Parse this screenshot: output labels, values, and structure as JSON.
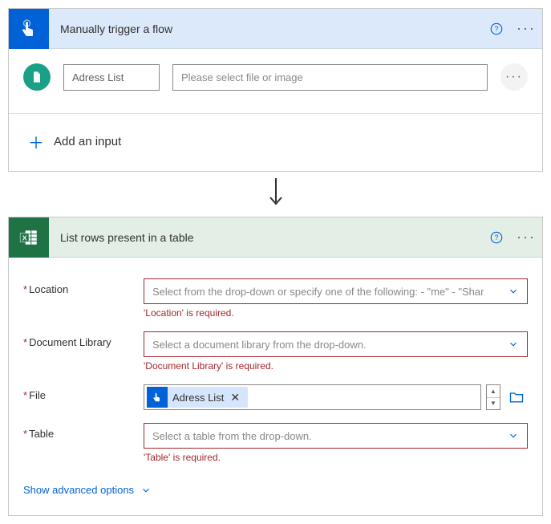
{
  "trigger": {
    "title": "Manually trigger a flow",
    "input_label": "Adress List",
    "input_placeholder": "Please select file or image",
    "add_input": "Add an input"
  },
  "action": {
    "title": "List rows present in a table",
    "fields": {
      "location": {
        "label": "Location",
        "placeholder": "Select from the drop-down or specify one of the following: - \"me\" - \"Shar",
        "error": "'Location' is required."
      },
      "library": {
        "label": "Document Library",
        "placeholder": "Select a document library from the drop-down.",
        "error": "'Document Library' is required."
      },
      "file": {
        "label": "File",
        "token": "Adress List"
      },
      "table": {
        "label": "Table",
        "placeholder": "Select a table from the drop-down.",
        "error": "'Table' is required."
      }
    },
    "advanced": "Show advanced options"
  }
}
